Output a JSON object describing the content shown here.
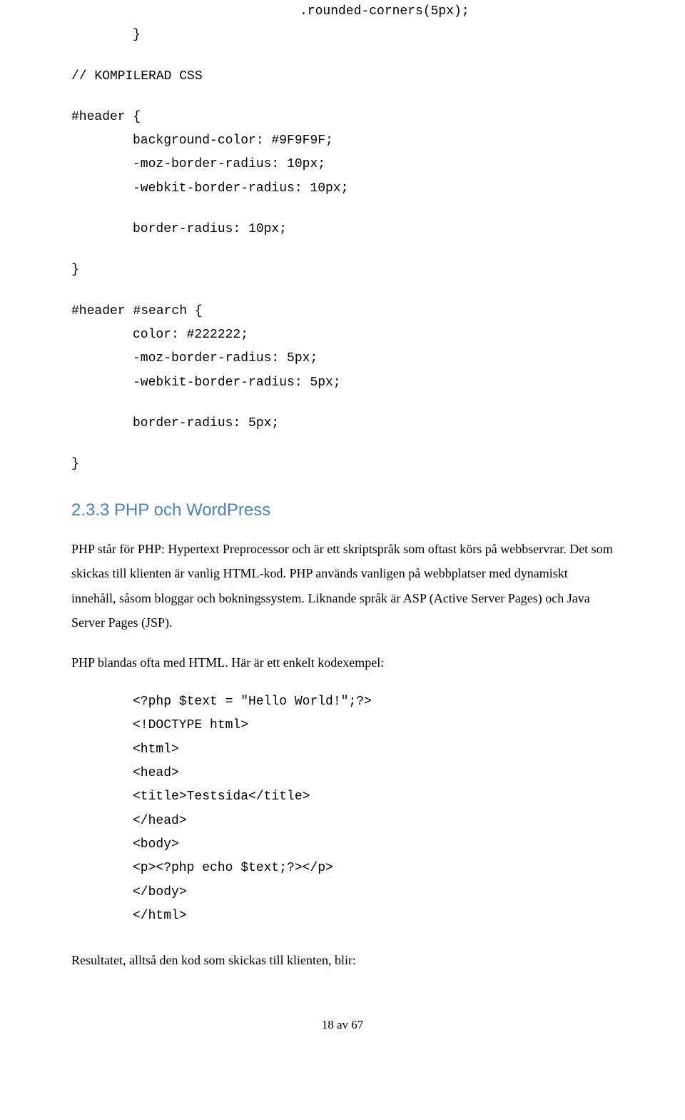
{
  "codeTop": {
    "l1": ".rounded-corners(5px);",
    "l2": "}",
    "l3": "// KOMPILERAD CSS",
    "l4": "#header {",
    "l5": "background-color: #9F9F9F;",
    "l6": "-moz-border-radius: 10px;",
    "l7": "-webkit-border-radius: 10px;",
    "l8": "border-radius: 10px;",
    "l9": "}",
    "l10": "#header #search {",
    "l11": "color: #222222;",
    "l12": "-moz-border-radius: 5px;",
    "l13": "-webkit-border-radius: 5px;",
    "l14": "border-radius: 5px;",
    "l15": "}"
  },
  "section": {
    "heading": "2.3.3 PHP och WordPress",
    "para1": "PHP står för PHP: Hypertext Preprocessor och är ett skriptspråk som oftast körs på webbservrar. Det som skickas till klienten är vanlig HTML-kod. PHP används vanligen på webbplatser med dynamiskt innehåll, såsom bloggar och bokningssystem. Liknande språk är ASP (Active Server Pages) och Java Server Pages (JSP).",
    "para2": "PHP blandas ofta med HTML. Här är ett enkelt kodexempel:"
  },
  "codeMid": {
    "l1": "<?php $text = \"Hello World!\";?>",
    "l2": "<!DOCTYPE html>",
    "l3": "<html>",
    "l4": "<head>",
    "l5": "<title>Testsida</title>",
    "l6": "</head>",
    "l7": "<body>",
    "l8": "<p><?php echo $text;?></p>",
    "l9": "</body>",
    "l10": "</html>"
  },
  "result": "Resultatet, alltså den kod som skickas till klienten, blir:",
  "page": "18 av 67"
}
